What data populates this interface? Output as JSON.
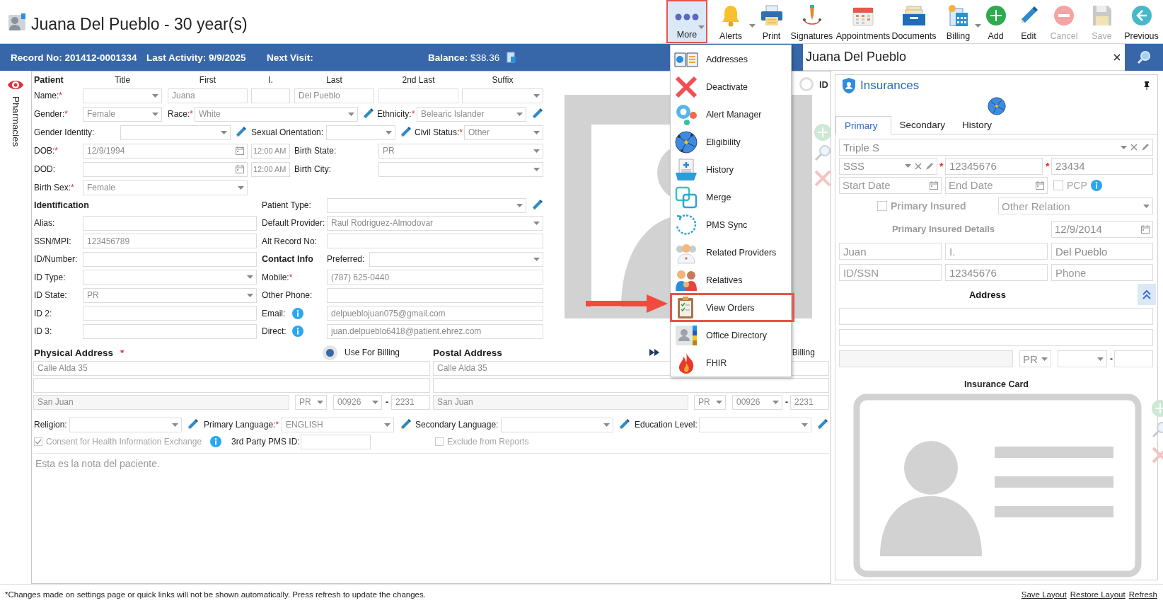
{
  "header": {
    "title": "Juana Del Pueblo - 30 year(s)"
  },
  "toolbar": [
    {
      "label": "More",
      "selected": true,
      "disabled": false,
      "dropdown": true
    },
    {
      "label": "Alerts",
      "selected": false,
      "disabled": false,
      "dropdown": true
    },
    {
      "label": "Print",
      "selected": false,
      "disabled": false,
      "dropdown": false
    },
    {
      "label": "Signatures",
      "selected": false,
      "disabled": false,
      "dropdown": false
    },
    {
      "label": "Appointments",
      "selected": false,
      "disabled": false,
      "dropdown": false
    },
    {
      "label": "Documents",
      "selected": false,
      "disabled": false,
      "dropdown": false
    },
    {
      "label": "Billing",
      "selected": false,
      "disabled": false,
      "dropdown": true
    },
    {
      "label": "Add",
      "selected": false,
      "disabled": false,
      "dropdown": false
    },
    {
      "label": "Edit",
      "selected": false,
      "disabled": false,
      "dropdown": false
    },
    {
      "label": "Cancel",
      "selected": false,
      "disabled": true,
      "dropdown": false
    },
    {
      "label": "Save",
      "selected": false,
      "disabled": true,
      "dropdown": false
    },
    {
      "label": "Previous",
      "selected": false,
      "disabled": false,
      "dropdown": false
    }
  ],
  "record_bar": {
    "items": [
      "Record No: 201412-0001334",
      "Last Activity: 9/9/2025",
      "Next Visit:",
      "**Balance:** $38.36"
    ]
  },
  "profile_header": {
    "title": "Juana Del Pueblo"
  },
  "side_tab": {
    "label": "Pharmacies"
  },
  "patient": {
    "heading": "Patient",
    "columns": [
      "Title",
      "First",
      "I.",
      "Last",
      "2nd Last",
      "Suffix"
    ],
    "name_row": {
      "label": "Name:",
      "mark": "*",
      "fields": [
        {
          "kind": "select"
        },
        {
          "kind": "text",
          "value": "Juana"
        },
        {
          "kind": "text"
        },
        {
          "kind": "text",
          "value": "Del Pueblo"
        },
        {
          "kind": "text"
        },
        {
          "kind": "select"
        }
      ]
    },
    "rows": [
      [
        {
          "kind": "label",
          "text": "Gender:",
          "mark": "*"
        },
        {
          "kind": "select",
          "value": "Female"
        },
        {
          "kind": "label",
          "text": "Race:",
          "mark": "*"
        },
        {
          "kind": "select",
          "value": "White"
        },
        {
          "kind": "edit"
        },
        {
          "kind": "label",
          "text": "Ethnicity:",
          "mark": "*"
        },
        {
          "kind": "select",
          "value": "Belearic Islander"
        },
        {
          "kind": "edit"
        }
      ],
      [
        {
          "kind": "label",
          "text": "Gender Identity:"
        },
        {
          "kind": "select"
        },
        {
          "kind": "edit"
        },
        {
          "kind": "label",
          "text": "Sexual Orientation:"
        },
        {
          "kind": "select"
        },
        {
          "kind": "edit"
        },
        {
          "kind": "label",
          "text": "Civil Status:",
          "mark": "*"
        },
        {
          "kind": "select",
          "value": "Other"
        }
      ],
      [
        {
          "kind": "label",
          "text": "DOB:",
          "mark": "*"
        },
        {
          "kind": "date",
          "value": "12/9/1994"
        },
        {
          "kind": "time",
          "value": "12:00 AM"
        },
        {
          "kind": "label",
          "text": "Birth State:"
        },
        {
          "kind": "select",
          "value": "PR"
        }
      ],
      [
        {
          "kind": "label",
          "text": "DOD:"
        },
        {
          "kind": "date"
        },
        {
          "kind": "time",
          "value": "12:00 AM"
        },
        {
          "kind": "label",
          "text": "Birth City:"
        },
        {
          "kind": "select"
        }
      ],
      [
        {
          "kind": "label",
          "text": "Birth Sex:",
          "mark": "*"
        },
        {
          "kind": "select",
          "value": "Female"
        }
      ]
    ],
    "identification_rows": [
      [
        {
          "kind": "heading",
          "text": "Identification"
        },
        {
          "kind": "label",
          "text": "Patient Type:"
        },
        {
          "kind": "select"
        },
        {
          "kind": "edit"
        }
      ],
      [
        {
          "kind": "label",
          "text": "Alias:"
        },
        {
          "kind": "text"
        },
        {
          "kind": "label",
          "text": "Default Provider:"
        },
        {
          "kind": "select",
          "value": "Raul Rodriguez-Almodovar"
        }
      ],
      [
        {
          "kind": "label",
          "text": "SSN/MPI:"
        },
        {
          "kind": "text",
          "value": "123456789"
        },
        {
          "kind": "label",
          "text": "Alt Record No:"
        },
        {
          "kind": "text"
        }
      ],
      [
        {
          "kind": "label",
          "text": "ID/Number:"
        },
        {
          "kind": "text"
        },
        {
          "kind": "heading",
          "text": "Contact Info"
        },
        {
          "kind": "label",
          "text": "Preferred:"
        },
        {
          "kind": "select"
        }
      ],
      [
        {
          "kind": "label",
          "text": "ID Type:"
        },
        {
          "kind": "select"
        },
        {
          "kind": "label",
          "text": "Mobile:",
          "mark": "*"
        },
        {
          "kind": "text",
          "value": "(787) 625-0440"
        }
      ],
      [
        {
          "kind": "label",
          "text": "ID State:"
        },
        {
          "kind": "select",
          "value": "PR"
        },
        {
          "kind": "label",
          "text": "Other Phone:"
        },
        {
          "kind": "text"
        }
      ],
      [
        {
          "kind": "label",
          "text": "ID 2:"
        },
        {
          "kind": "text"
        },
        {
          "kind": "label",
          "text": "Email:"
        },
        {
          "kind": "info"
        },
        {
          "kind": "text",
          "value": "delpueblojuan075@gmail.com"
        }
      ],
      [
        {
          "kind": "label",
          "text": "ID 3:"
        },
        {
          "kind": "text"
        },
        {
          "kind": "label",
          "text": "Direct:"
        },
        {
          "kind": "info"
        },
        {
          "kind": "text",
          "value": "juan.delpueblo6418@patient.ehrez.com"
        }
      ]
    ],
    "physical_address": {
      "title": "Physical Address",
      "mark": "*",
      "use_for_billing": {
        "label": "Use For Billing",
        "selected": true
      },
      "rows": [
        [
          {
            "kind": "text",
            "value": "Calle Alda 35"
          }
        ],
        [
          {
            "kind": "text"
          }
        ],
        [
          {
            "kind": "city",
            "value": "San Juan"
          },
          {
            "kind": "select",
            "value": "PR"
          },
          {
            "kind": "select",
            "value": "00926"
          },
          {
            "kind": "sep",
            "text": "-"
          },
          {
            "kind": "text",
            "value": "2231"
          }
        ]
      ]
    },
    "postal_address": {
      "title": "Postal Address",
      "billing_label": "Billing",
      "rows": [
        [
          {
            "kind": "text",
            "value": "Calle Alda 35"
          }
        ],
        [
          {
            "kind": "text"
          }
        ],
        [
          {
            "kind": "city",
            "value": "San Juan"
          },
          {
            "kind": "select",
            "value": "PR"
          },
          {
            "kind": "select",
            "value": "00926"
          },
          {
            "kind": "sep",
            "text": "-"
          },
          {
            "kind": "text",
            "value": "2231"
          }
        ]
      ]
    },
    "language_row": [
      {
        "kind": "label",
        "text": "Religion:"
      },
      {
        "kind": "select"
      },
      {
        "kind": "edit"
      },
      {
        "kind": "label",
        "text": "Primary Language:",
        "mark": "*"
      },
      {
        "kind": "select",
        "value": "ENGLISH"
      },
      {
        "kind": "edit"
      },
      {
        "kind": "label",
        "text": "Secondary Language:"
      },
      {
        "kind": "select"
      },
      {
        "kind": "edit"
      },
      {
        "kind": "label",
        "text": "Education Level:"
      },
      {
        "kind": "select"
      },
      {
        "kind": "edit"
      }
    ],
    "options_row": [
      {
        "kind": "check",
        "text": "Consent for Health Information Exchange",
        "checked": true
      },
      {
        "kind": "info"
      },
      {
        "kind": "label",
        "text": "3rd Party PMS ID:"
      },
      {
        "kind": "text"
      },
      {
        "kind": "check",
        "text": "Exclude from Reports",
        "checked": false
      }
    ],
    "notes": "Esta es la nota del paciente."
  },
  "photo": {
    "id_toggle": {
      "label": "ID",
      "on": false
    }
  },
  "more_menu": {
    "items": [
      {
        "label": "Addresses",
        "selected": false
      },
      {
        "label": "Deactivate",
        "selected": false
      },
      {
        "label": "Alert Manager",
        "selected": false
      },
      {
        "label": "Eligibility",
        "selected": false
      },
      {
        "label": "History",
        "selected": false
      },
      {
        "label": "Merge",
        "selected": false
      },
      {
        "label": "PMS Sync",
        "selected": false
      },
      {
        "label": "Related Providers",
        "selected": false
      },
      {
        "label": "Relatives",
        "selected": false
      },
      {
        "label": "View Orders",
        "selected": true
      },
      {
        "label": "Office Directory",
        "selected": false
      },
      {
        "label": "FHIR",
        "selected": false
      }
    ]
  },
  "insurances": {
    "title": "Insurances",
    "tabs": [
      {
        "label": "Primary",
        "selected": true
      },
      {
        "label": "Secondary",
        "selected": false
      },
      {
        "label": "History",
        "selected": false
      }
    ],
    "rows": [
      [
        {
          "kind": "combo",
          "value": "Triple S"
        }
      ],
      [
        {
          "kind": "combo",
          "value": "SSS"
        },
        {
          "kind": "mark",
          "text": "*"
        },
        {
          "kind": "text",
          "value": "12345676"
        },
        {
          "kind": "mark",
          "text": "*"
        },
        {
          "kind": "text",
          "value": "23434"
        }
      ],
      [
        {
          "kind": "date",
          "placeholder": "Start Date"
        },
        {
          "kind": "date",
          "placeholder": "End Date"
        },
        {
          "kind": "check",
          "text": "PCP",
          "checked": false
        },
        {
          "kind": "info"
        }
      ],
      [
        {
          "kind": "bold_check",
          "text": "Primary Insured",
          "checked": false
        },
        {
          "kind": "select",
          "placeholder": "Other Relation"
        }
      ],
      [
        {
          "kind": "subheading",
          "text": "Primary Insured Details"
        },
        {
          "kind": "date",
          "value": "12/9/2014"
        }
      ],
      [
        {
          "kind": "text",
          "value": "Juan"
        },
        {
          "kind": "text",
          "placeholder": "I."
        },
        {
          "kind": "text",
          "value": "Del Pueblo"
        }
      ],
      [
        {
          "kind": "text",
          "placeholder": "ID/SSN"
        },
        {
          "kind": "text",
          "value": "12345676"
        },
        {
          "kind": "text",
          "placeholder": "Phone"
        }
      ],
      [
        {
          "kind": "center_heading",
          "text": "Address"
        },
        {
          "kind": "collapse"
        }
      ],
      [
        {
          "kind": "text"
        }
      ],
      [
        {
          "kind": "text"
        }
      ],
      [
        {
          "kind": "city"
        },
        {
          "kind": "select",
          "value": "PR"
        },
        {
          "kind": "select"
        },
        {
          "kind": "sep",
          "text": "-"
        },
        {
          "kind": "text"
        }
      ]
    ],
    "card_title": "Insurance Card"
  },
  "footer": {
    "note": "*Changes made on settings page or quick links will not be shown automatically. Press refresh to update the changes.",
    "links": [
      "Save Layout",
      "Restore Layout",
      "Refresh"
    ]
  }
}
